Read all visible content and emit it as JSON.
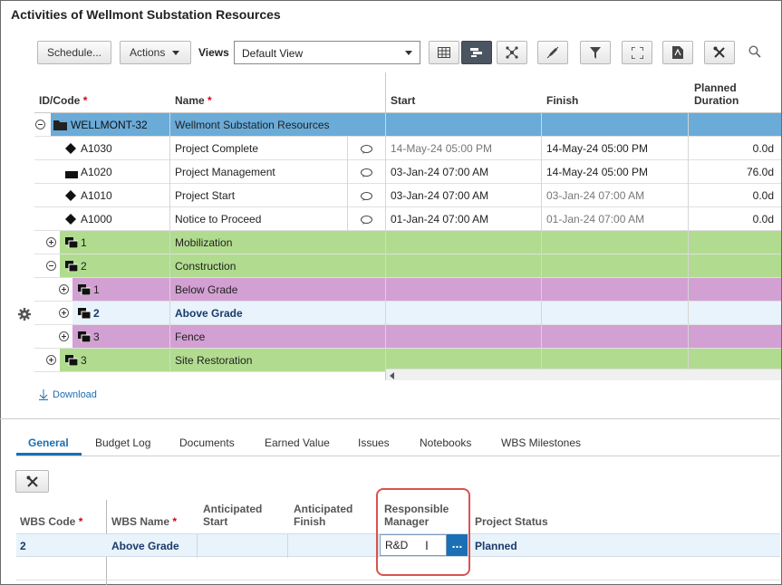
{
  "page": {
    "title": "Activities of Wellmont Substation Resources"
  },
  "toolbar": {
    "schedule_label": "Schedule...",
    "actions_label": "Actions",
    "views_label": "Views",
    "view_selected": "Default View",
    "icons": [
      "table-icon",
      "gantt-icon",
      "network-icon",
      "edit-icon",
      "filter-icon",
      "expand-icon",
      "pdf-icon",
      "tools-icon",
      "search-icon"
    ]
  },
  "grid": {
    "headers": {
      "id": "ID/Code",
      "name": "Name",
      "start": "Start",
      "finish": "Finish",
      "duration_1": "Planned",
      "duration_2": "Duration",
      "required": "*"
    },
    "rows": [
      {
        "id": "WELLMONT-32",
        "name": "Wellmont Substation Resources",
        "start": "",
        "finish": "",
        "duration": "",
        "icon": "folder-icon"
      },
      {
        "id": "A1030",
        "name": "Project Complete",
        "start": "14-May-24 05:00 PM",
        "finish": "14-May-24 05:00 PM",
        "duration": "0.0d",
        "icon": "milestone-icon"
      },
      {
        "id": "A1020",
        "name": "Project Management",
        "start": "03-Jan-24 07:00 AM",
        "finish": "14-May-24 05:00 PM",
        "duration": "76.0d",
        "icon": "task-bar-icon"
      },
      {
        "id": "A1010",
        "name": "Project Start",
        "start": "03-Jan-24 07:00 AM",
        "finish": "03-Jan-24 07:00 AM",
        "duration": "0.0d",
        "icon": "milestone-icon"
      },
      {
        "id": "A1000",
        "name": "Notice to Proceed",
        "start": "01-Jan-24 07:00 AM",
        "finish": "01-Jan-24 07:00 AM",
        "duration": "0.0d",
        "icon": "milestone-icon"
      },
      {
        "id": "1",
        "name": "Mobilization"
      },
      {
        "id": "2",
        "name": "Construction"
      },
      {
        "id": "1",
        "name": "Below Grade"
      },
      {
        "id": "2",
        "name": "Above Grade"
      },
      {
        "id": "3",
        "name": "Fence"
      },
      {
        "id": "3",
        "name": "Site Restoration"
      }
    ]
  },
  "download_label": "Download",
  "tabs": [
    "General",
    "Budget Log",
    "Documents",
    "Earned Value",
    "Issues",
    "Notebooks",
    "WBS Milestones"
  ],
  "detail": {
    "headers": {
      "wbs_code": "WBS Code",
      "wbs_name": "WBS Name",
      "anticipated_start_1": "Anticipated",
      "anticipated_start_2": "Start",
      "anticipated_finish_1": "Anticipated",
      "anticipated_finish_2": "Finish",
      "responsible_1": "Responsible",
      "responsible_2": "Manager",
      "project_status": "Project Status"
    },
    "row": {
      "wbs_code": "2",
      "wbs_name": "Above Grade",
      "anticipated_start": "",
      "anticipated_finish": "",
      "responsible_manager": "R&D",
      "project_status": "Planned"
    },
    "edit_button_label": "..."
  },
  "colors": {
    "selected_row": "#6aabd8",
    "green_row": "#b1dc8f",
    "purple_row": "#d3a0d3",
    "light_blue_row": "#e8f3fb",
    "accent": "#1b6fb5",
    "highlight_border": "#d9534f"
  }
}
